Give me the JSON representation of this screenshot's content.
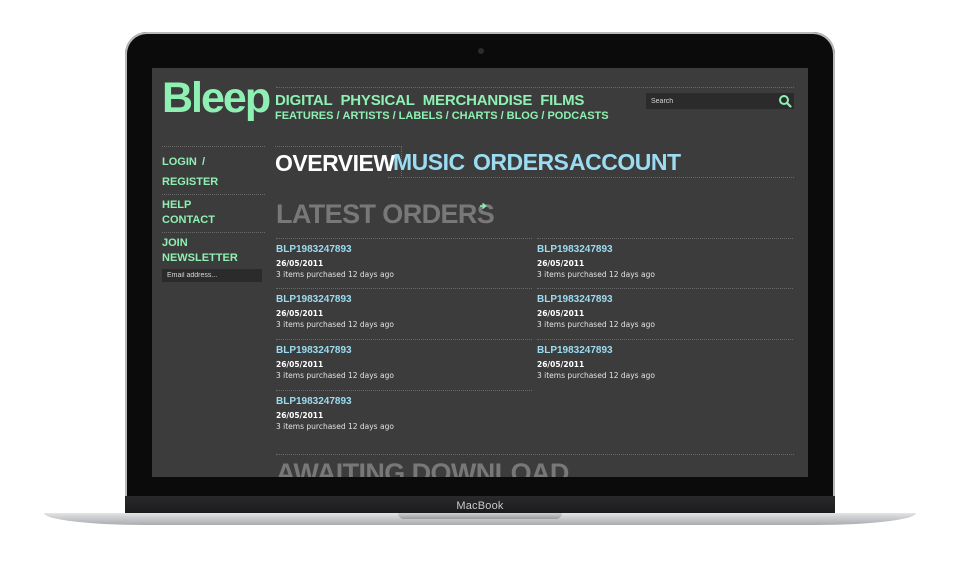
{
  "device": {
    "brand": "MacBook"
  },
  "site": {
    "logo": "Bleep",
    "nav_main": [
      "DIGITAL",
      "PHYSICAL",
      "MERCHANDISE",
      "FILMS"
    ],
    "nav_sub": [
      "FEATURES",
      "ARTISTS",
      "LABELS",
      "CHARTS",
      "BLOG",
      "PODCASTS"
    ],
    "search": {
      "placeholder": "Search"
    }
  },
  "sidebar": {
    "login": "LOGIN",
    "login_sep": "/",
    "register": "REGISTER",
    "help": "HELP",
    "contact": "CONTACT",
    "newsletter_label": "JOIN NEWSLETTER",
    "email_placeholder": "Email address..."
  },
  "tabs": [
    "OVERVIEW",
    "MUSIC",
    "ORDERS",
    "ACCOUNT"
  ],
  "latest_orders": {
    "title": "LATEST ORDERS",
    "items": [
      {
        "id": "BLP1983247893",
        "date": "26/05/2011",
        "meta": "3 items purchased 12 days ago"
      },
      {
        "id": "BLP1983247893",
        "date": "26/05/2011",
        "meta": "3 items purchased 12 days ago"
      },
      {
        "id": "BLP1983247893",
        "date": "26/05/2011",
        "meta": "3 items purchased 12 days ago"
      },
      {
        "id": "BLP1983247893",
        "date": "26/05/2011",
        "meta": "3 items purchased 12 days ago"
      },
      {
        "id": "BLP1983247893",
        "date": "26/05/2011",
        "meta": "3 items purchased 12 days ago"
      },
      {
        "id": "BLP1983247893",
        "date": "26/05/2011",
        "meta": "3 items purchased 12 days ago"
      },
      {
        "id": "BLP1983247893",
        "date": "26/05/2011",
        "meta": "3 items purchased 12 days ago"
      }
    ]
  },
  "awaiting_download": {
    "title": "AWAITING DOWNLOAD"
  },
  "colors": {
    "accent_green": "#8ef0b2",
    "accent_blue": "#9bdcf2",
    "background": "#3c3c3c"
  }
}
